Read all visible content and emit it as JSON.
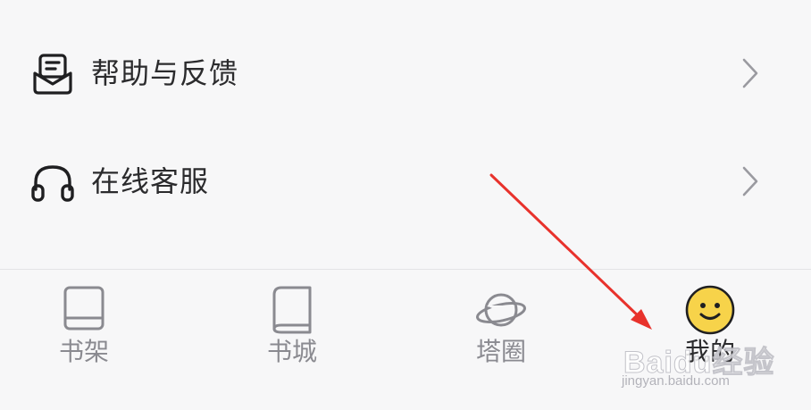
{
  "menu": {
    "items": [
      {
        "label": "帮助与反馈",
        "icon": "help-feedback-icon"
      },
      {
        "label": "在线客服",
        "icon": "headset-icon"
      }
    ]
  },
  "tabbar": {
    "tabs": [
      {
        "label": "书架",
        "icon": "bookshelf-icon",
        "active": false
      },
      {
        "label": "书城",
        "icon": "bookstore-icon",
        "active": false
      },
      {
        "label": "塔圈",
        "icon": "planet-icon",
        "active": false
      },
      {
        "label": "我的",
        "icon": "smiley-icon",
        "active": true
      }
    ]
  },
  "annotation": {
    "color": "#e8322c"
  },
  "watermark": {
    "brand": "Baidu经验",
    "url": "jingyan.baidu.com"
  },
  "colors": {
    "background": "#f7f7f8",
    "text": "#2b2b2d",
    "inactive": "#8a8a90",
    "active_icon": "#f7d34a"
  }
}
